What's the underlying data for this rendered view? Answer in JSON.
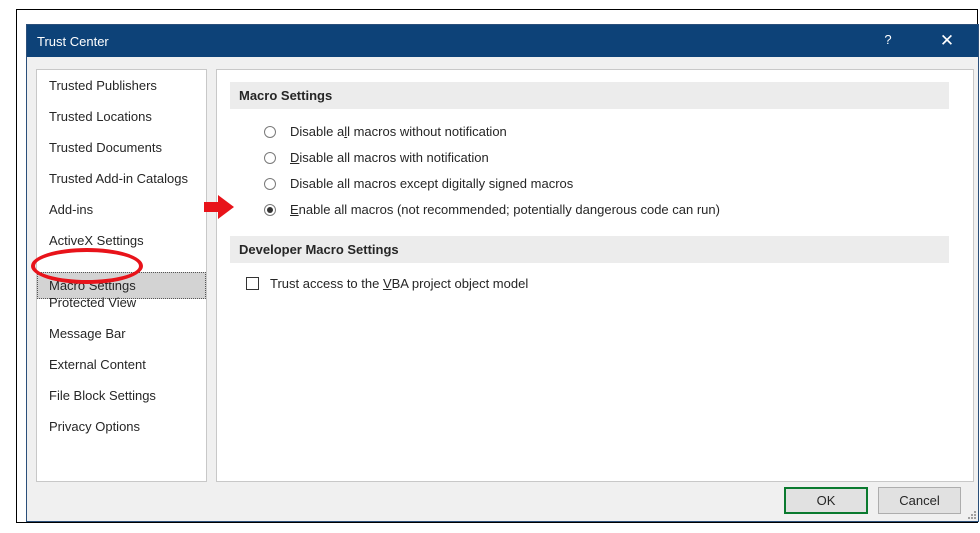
{
  "dialog": {
    "title": "Trust Center",
    "help": "?",
    "close": "✕"
  },
  "nav": {
    "items": [
      {
        "label": "Trusted Publishers"
      },
      {
        "label": "Trusted Locations"
      },
      {
        "label": "Trusted Documents"
      },
      {
        "label": "Trusted Add-in Catalogs"
      },
      {
        "label": "Add-ins"
      },
      {
        "label": "ActiveX Settings"
      },
      {
        "label": "Macro Settings",
        "selected": true
      },
      {
        "label": "Protected View"
      },
      {
        "label": "Message Bar"
      },
      {
        "label": "External Content"
      },
      {
        "label": "File Block Settings"
      },
      {
        "label": "Privacy Options"
      }
    ]
  },
  "macro_settings": {
    "header": "Macro Settings",
    "options": [
      {
        "pre": "Disable a",
        "key": "l",
        "post": "l macros without notification",
        "checked": false
      },
      {
        "pre": "",
        "key": "D",
        "post": "isable all macros with notification",
        "checked": false
      },
      {
        "pre": "Disable all macros except di",
        "key": "g",
        "post": "itally signed macros",
        "checked": false
      },
      {
        "pre": "",
        "key": "E",
        "post": "nable all macros (not recommended; potentially dangerous code can run)",
        "checked": true
      }
    ]
  },
  "developer_settings": {
    "header": "Developer Macro Settings",
    "vba_pre": "Trust access to the ",
    "vba_key": "V",
    "vba_post": "BA project object model",
    "vba_checked": false
  },
  "buttons": {
    "ok": "OK",
    "cancel": "Cancel"
  },
  "colors": {
    "titlebar": "#0d4278",
    "annotation_red": "#e8131a",
    "ok_border": "#0a7a2f"
  },
  "annotations": {
    "ellipse_target": "Macro Settings",
    "arrow_target": "Enable all macros option"
  }
}
